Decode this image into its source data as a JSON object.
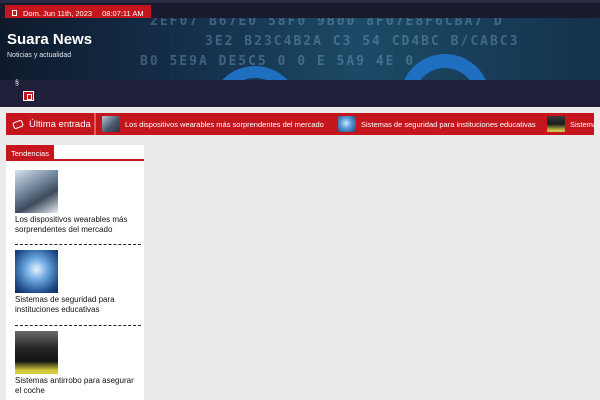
{
  "topbar": {
    "date": "Dom. Jun 11th, 2023",
    "time": "08:07:11 AM"
  },
  "header": {
    "site_title": "Suara News",
    "site_description": "Noticias y actualidad",
    "hex_rows": [
      "2EF07  B67E0 58F0 9B00  8F07E8F6CBA7 D",
      "3E2  B23C4B2A  C3 54  CD4BC  B/CABC3",
      "B0  5E9A  DE5C5  0 0  E 5A9    4E 0"
    ]
  },
  "nav": {
    "icon_label": "§"
  },
  "ticker": {
    "label": "Última entrada",
    "items": [
      {
        "title": "Los dispositivos wearables más sorprendentes del mercado",
        "thumb": "wearables"
      },
      {
        "title": "Sistemas de seguridad para instituciones educativas",
        "thumb": "security"
      },
      {
        "title": "Sistemas antirrobo para asegurar el coche",
        "thumb": "car"
      }
    ]
  },
  "sidebar": {
    "heading": "Tendencias",
    "posts": [
      {
        "title": "Los dispositivos wearables más sorprendentes del mercado"
      },
      {
        "title": "Sistemas de seguridad para instituciones educativas"
      },
      {
        "title": "Sistemas antirrobo para asegurar el coche"
      }
    ]
  },
  "colors": {
    "accent": "#c4161c",
    "nav_bg": "#1f1f3a",
    "page_bg": "#ebebeb"
  }
}
